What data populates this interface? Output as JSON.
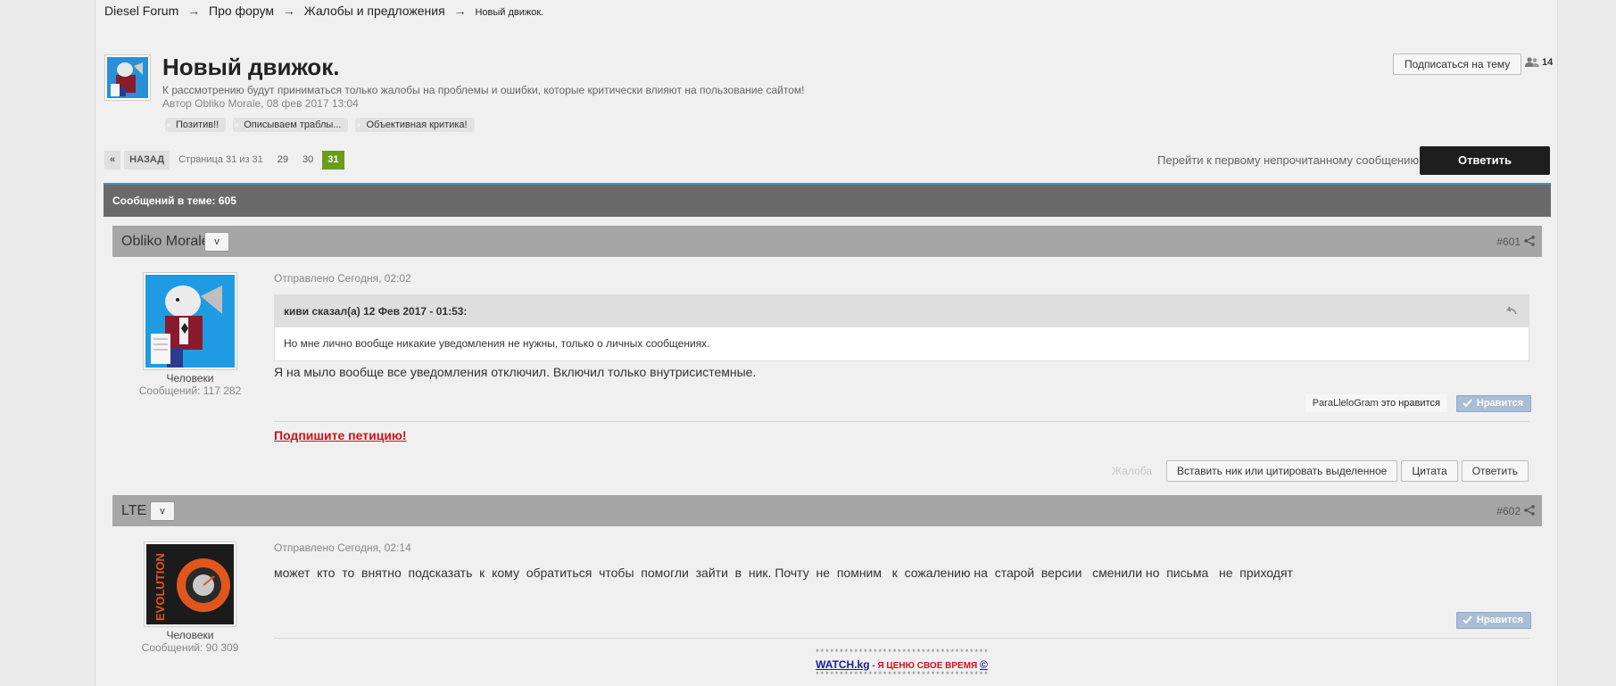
{
  "breadcrumb": {
    "items": [
      "Diesel Forum",
      "Про форум",
      "Жалобы и предложения"
    ],
    "current": "Новый движок.",
    "separator": "→"
  },
  "topic": {
    "title": "Новый движок.",
    "description": "К рассмотрению будут приниматься только жалобы на проблемы и ошибки, которые критически влияют на пользование сайтом!",
    "meta": "Автор Obliko Morale, 08 фев 2017 13:04",
    "tags": [
      "Позитив!!",
      "Описываем траблы...",
      "Объективная критика!"
    ],
    "subscribe_label": "Подписаться на тему",
    "followers_count": "14"
  },
  "pagination": {
    "prev_arrow": "«",
    "back_label": "НАЗАД",
    "page_info": "Страница 31 из 31",
    "pages": [
      "29",
      "30",
      "31"
    ],
    "active_page": "31"
  },
  "actions": {
    "first_unread": "Перейти к первому непрочитанному сообщению",
    "reply": "Ответить"
  },
  "posts_count_label": "Сообщений в теме: 605",
  "posts": [
    {
      "author": "Obliko Morale",
      "toggle": "v",
      "number": "#601",
      "group": "Человеки",
      "post_count": "Сообщений: 117 282",
      "posted": "Отправлено Сегодня, 02:02",
      "quote": {
        "header": "киви сказал(а) 12 Фев 2017 - 01:53:",
        "text": "Но мне лично вообще никакие уведомления не нужны, только о личных сообщениях."
      },
      "text": "Я на мыло вообще все уведомления отключил. Включил только внутрисистемные.",
      "likers": "ParaLlelоGram",
      "likers_suffix": "это нравится",
      "like_label": "Нравится",
      "signature_link": "Подпишите петицию!",
      "complaint": "Жалоба",
      "buttons": [
        "Вставить ник или цитировать выделенное",
        "Цитата",
        "Ответить"
      ]
    },
    {
      "author": "LTE",
      "toggle": "v",
      "number": "#602",
      "group": "Человеки",
      "post_count": "Сообщений: 90 309",
      "posted": "Отправлено Сегодня, 02:14",
      "text": "может  кто  то  внятно  подсказать  к  кому  обратиться  чтобы  помогли  зайти  в  ник. Почту  не  помним   к  сожалению на  старой  версии   сменили но  письма   не  приходят",
      "like_label": "Нравится",
      "signature": {
        "stars": "************************************",
        "link": "WATCH.kg",
        "dash": " - ",
        "slogan": "Я ЦЕНЮ СВОЕ ВРЕМЯ",
        "copyright": "©"
      }
    }
  ],
  "colors": {
    "active_page": "#6b9c1a",
    "header_bar": "#6a6a6a",
    "post_head": "#a6a6a6",
    "petition": "#d0111b",
    "like_button": "#a9bed6"
  }
}
